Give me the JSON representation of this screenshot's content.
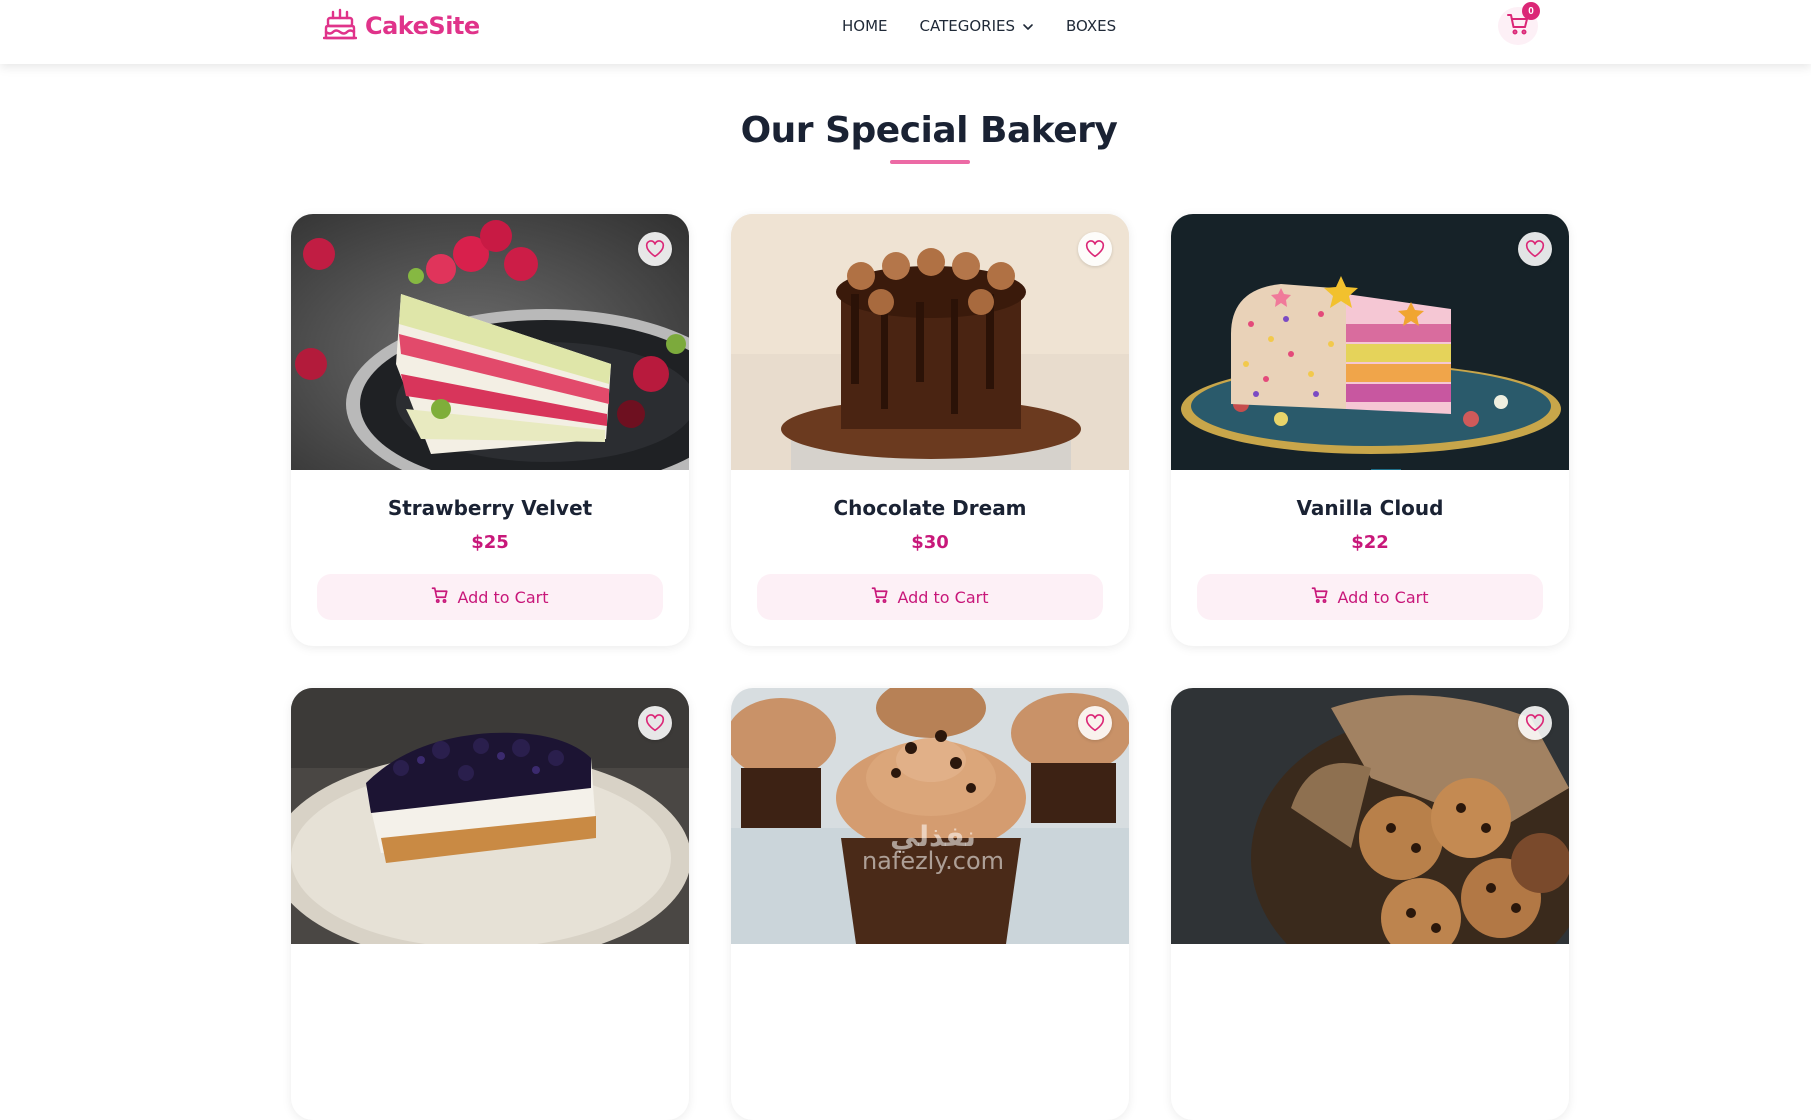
{
  "header": {
    "brand": "CakeSite",
    "nav": [
      {
        "label": "HOME"
      },
      {
        "label": "CATEGORIES"
      },
      {
        "label": "BOXES"
      }
    ],
    "cart_count": "0"
  },
  "section": {
    "title": "Our Special Bakery"
  },
  "products": [
    {
      "name": "Strawberry Velvet",
      "price": "$25",
      "button": "Add to Cart"
    },
    {
      "name": "Chocolate Dream",
      "price": "$30",
      "button": "Add to Cart"
    },
    {
      "name": "Vanilla Cloud",
      "price": "$22",
      "button": "Add to Cart"
    }
  ],
  "watermark": {
    "arabic": "نفذلي",
    "latin": "nafezly.com"
  },
  "colors": {
    "accent": "#e0338a",
    "price": "#c8187a",
    "button_bg": "#fdf0f6",
    "badge": "#db2777"
  }
}
